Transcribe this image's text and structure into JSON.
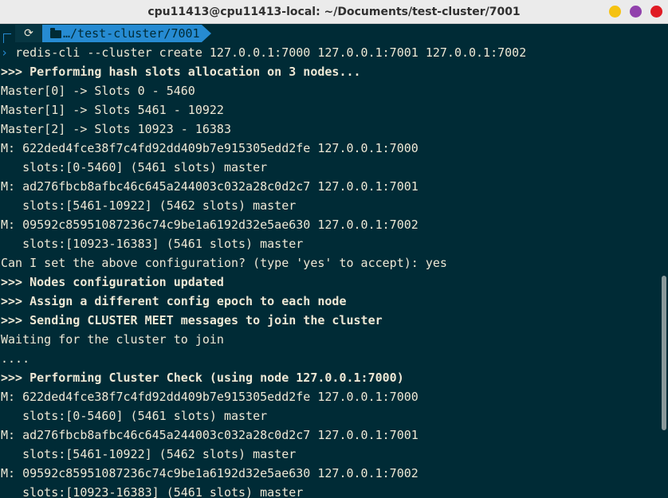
{
  "window": {
    "title": "cpu11413@cpu11413-local: ~/Documents/test-cluster/7001",
    "buttons": {
      "minimize_color": "#f5c211",
      "maximize_color": "#9141ac",
      "close_color": "#e01b24"
    }
  },
  "prompt": {
    "os_icon": "ubuntu-icon",
    "os_glyph": "⟳",
    "dir_icon": "folder-icon",
    "dir": "…/test-cluster/7001",
    "cmd_arrow": "›",
    "command": "redis-cli --cluster create 127.0.0.1:7000 127.0.0.1:7001 127.0.0.1:7002"
  },
  "output": [
    {
      "text": ">>> Performing hash slots allocation on 3 nodes...",
      "bold": true
    },
    {
      "text": "Master[0] -> Slots 0 - 5460",
      "bold": false
    },
    {
      "text": "Master[1] -> Slots 5461 - 10922",
      "bold": false
    },
    {
      "text": "Master[2] -> Slots 10923 - 16383",
      "bold": false
    },
    {
      "text": "M: 622ded4fce38f7c4fd92dd409b7e915305edd2fe 127.0.0.1:7000",
      "bold": false
    },
    {
      "text": "   slots:[0-5460] (5461 slots) master",
      "bold": false
    },
    {
      "text": "M: ad276fbcb8afbc46c645a244003c032a28c0d2c7 127.0.0.1:7001",
      "bold": false
    },
    {
      "text": "   slots:[5461-10922] (5462 slots) master",
      "bold": false
    },
    {
      "text": "M: 09592c85951087236c74c9be1a6192d32e5ae630 127.0.0.1:7002",
      "bold": false
    },
    {
      "text": "   slots:[10923-16383] (5461 slots) master",
      "bold": false
    },
    {
      "text": "Can I set the above configuration? (type 'yes' to accept): yes",
      "bold": false
    },
    {
      "text": ">>> Nodes configuration updated",
      "bold": true
    },
    {
      "text": ">>> Assign a different config epoch to each node",
      "bold": true
    },
    {
      "text": ">>> Sending CLUSTER MEET messages to join the cluster",
      "bold": true
    },
    {
      "text": "Waiting for the cluster to join",
      "bold": false
    },
    {
      "text": "....",
      "bold": false
    },
    {
      "text": ">>> Performing Cluster Check (using node 127.0.0.1:7000)",
      "bold": true
    },
    {
      "text": "M: 622ded4fce38f7c4fd92dd409b7e915305edd2fe 127.0.0.1:7000",
      "bold": false
    },
    {
      "text": "   slots:[0-5460] (5461 slots) master",
      "bold": false
    },
    {
      "text": "M: ad276fbcb8afbc46c645a244003c032a28c0d2c7 127.0.0.1:7001",
      "bold": false
    },
    {
      "text": "   slots:[5461-10922] (5462 slots) master",
      "bold": false
    },
    {
      "text": "M: 09592c85951087236c74c9be1a6192d32e5ae630 127.0.0.1:7002",
      "bold": false
    },
    {
      "text": "   slots:[10923-16383] (5461 slots) master",
      "bold": false
    }
  ],
  "colors": {
    "background": "#002b36",
    "foreground": "#eee8d5",
    "accent": "#268bd2",
    "segment_dark": "#073642"
  }
}
